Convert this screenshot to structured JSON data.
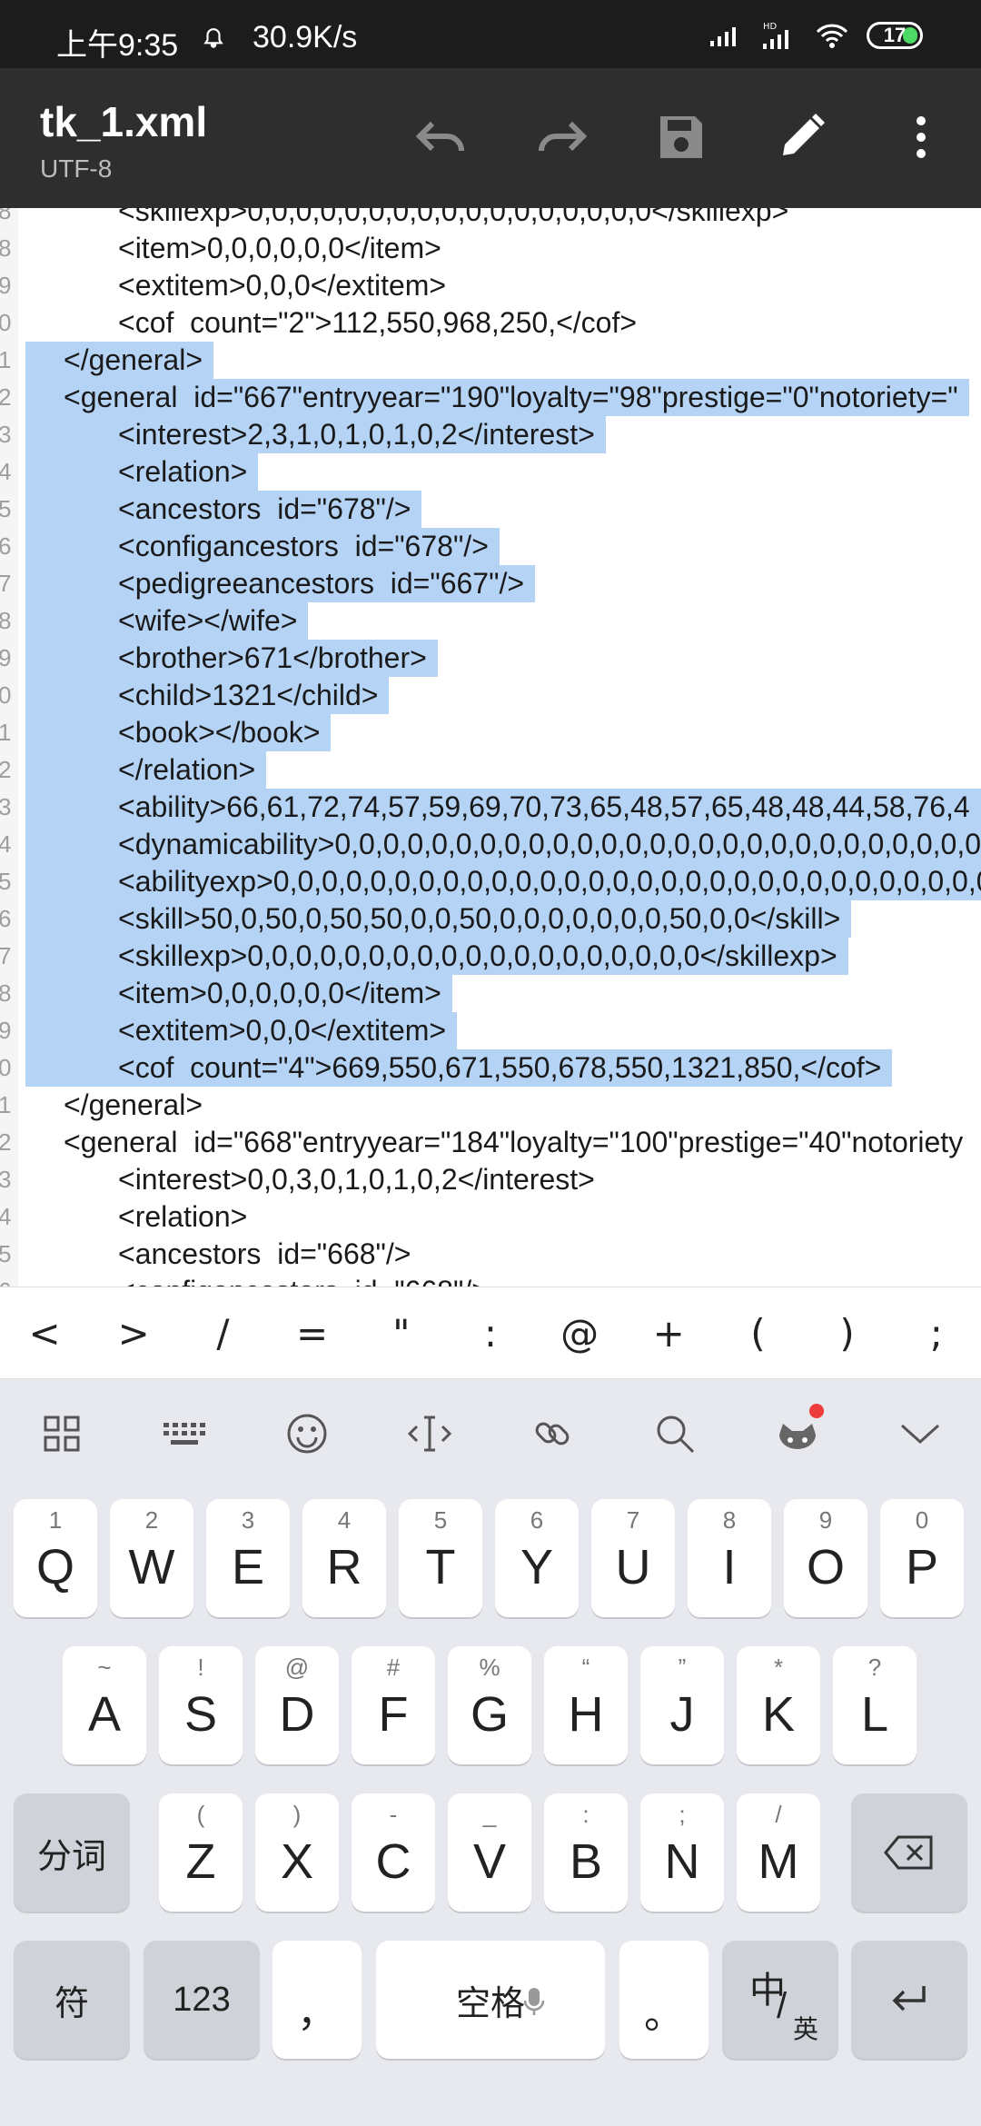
{
  "status": {
    "time": "上午9:35",
    "speed": "30.9K/s",
    "battery": "17"
  },
  "app": {
    "title": "tk_1.xml",
    "encoding": "UTF-8"
  },
  "editor": {
    "lines": [
      {
        "n": "8",
        "t": "<skillexp>0,0,0,0,0,0,0,0,0,0,0,0,0,0,0,0,0</skillexp>",
        "ind": 2,
        "sel": false
      },
      {
        "n": "8",
        "t": "<item>0,0,0,0,0,0</item>",
        "ind": 2,
        "sel": false
      },
      {
        "n": "9",
        "t": "<extitem>0,0,0</extitem>",
        "ind": 2,
        "sel": false
      },
      {
        "n": "0",
        "t": "<cof  count=\"2\">112,550,968,250,</cof>",
        "ind": 2,
        "sel": false
      },
      {
        "n": "1",
        "t": "</general>",
        "ind": 1,
        "sel": true
      },
      {
        "n": "2",
        "t": "<general  id=\"667\"entryyear=\"190\"loyalty=\"98\"prestige=\"0\"notoriety=\"",
        "ind": 1,
        "sel": true
      },
      {
        "n": "3",
        "t": "<interest>2,3,1,0,1,0,1,0,2</interest>",
        "ind": 2,
        "sel": true
      },
      {
        "n": "4",
        "t": "<relation>",
        "ind": 2,
        "sel": true
      },
      {
        "n": "5",
        "t": "<ancestors  id=\"678\"/>",
        "ind": 2,
        "sel": true
      },
      {
        "n": "6",
        "t": "<configancestors  id=\"678\"/>",
        "ind": 2,
        "sel": true
      },
      {
        "n": "7",
        "t": "<pedigreeancestors  id=\"667\"/>",
        "ind": 2,
        "sel": true
      },
      {
        "n": "8",
        "t": "<wife></wife>",
        "ind": 2,
        "sel": true
      },
      {
        "n": "9",
        "t": "<brother>671</brother>",
        "ind": 2,
        "sel": true
      },
      {
        "n": "0",
        "t": "<child>1321</child>",
        "ind": 2,
        "sel": true
      },
      {
        "n": "1",
        "t": "<book></book>",
        "ind": 2,
        "sel": true
      },
      {
        "n": "2",
        "t": "</relation>",
        "ind": 2,
        "sel": true
      },
      {
        "n": "3",
        "t": "<ability>66,61,72,74,57,59,69,70,73,65,48,57,65,48,48,44,58,76,4",
        "ind": 2,
        "sel": true
      },
      {
        "n": "4",
        "t": "<dynamicability>0,0,0,0,0,0,0,0,0,0,0,0,0,0,0,0,0,0,0,0,0,0,0,0,0,0,0,0",
        "ind": 2,
        "sel": true
      },
      {
        "n": "5",
        "t": "<abilityexp>0,0,0,0,0,0,0,0,0,0,0,0,0,0,0,0,0,0,0,0,0,0,0,0,0,0,0,0,0,0",
        "ind": 2,
        "sel": true
      },
      {
        "n": "6",
        "t": "<skill>50,0,50,0,50,50,0,0,50,0,0,0,0,0,0,0,50,0,0</skill>",
        "ind": 2,
        "sel": true
      },
      {
        "n": "7",
        "t": "<skillexp>0,0,0,0,0,0,0,0,0,0,0,0,0,0,0,0,0,0,0</skillexp>",
        "ind": 2,
        "sel": true
      },
      {
        "n": "8",
        "t": "<item>0,0,0,0,0,0</item>",
        "ind": 2,
        "sel": true
      },
      {
        "n": "9",
        "t": "<extitem>0,0,0</extitem>",
        "ind": 2,
        "sel": true
      },
      {
        "n": "0",
        "t": "<cof  count=\"4\">669,550,671,550,678,550,1321,850,</cof>",
        "ind": 2,
        "sel": true
      },
      {
        "n": "1",
        "t": "</general>",
        "ind": 1,
        "sel": false
      },
      {
        "n": "2",
        "t": "<general  id=\"668\"entryyear=\"184\"loyalty=\"100\"prestige=\"40\"notoriety",
        "ind": 1,
        "sel": false
      },
      {
        "n": "3",
        "t": "<interest>0,0,3,0,1,0,1,0,2</interest>",
        "ind": 2,
        "sel": false
      },
      {
        "n": "4",
        "t": "<relation>",
        "ind": 2,
        "sel": false
      },
      {
        "n": "5",
        "t": "<ancestors  id=\"668\"/>",
        "ind": 2,
        "sel": false
      },
      {
        "n": "6",
        "t": "<configancestors  id=\"668\"/>",
        "ind": 2,
        "sel": false
      }
    ]
  },
  "symbols": [
    "<",
    ">",
    "/",
    "=",
    "\"",
    ":",
    "@",
    "+",
    "(",
    ")",
    ";"
  ],
  "keyboard": {
    "row1": [
      {
        "h": "1",
        "k": "Q"
      },
      {
        "h": "2",
        "k": "W"
      },
      {
        "h": "3",
        "k": "E"
      },
      {
        "h": "4",
        "k": "R"
      },
      {
        "h": "5",
        "k": "T"
      },
      {
        "h": "6",
        "k": "Y"
      },
      {
        "h": "7",
        "k": "U"
      },
      {
        "h": "8",
        "k": "I"
      },
      {
        "h": "9",
        "k": "O"
      },
      {
        "h": "0",
        "k": "P"
      }
    ],
    "row2": [
      {
        "h": "~",
        "k": "A"
      },
      {
        "h": "!",
        "k": "S"
      },
      {
        "h": "@",
        "k": "D"
      },
      {
        "h": "#",
        "k": "F"
      },
      {
        "h": "%",
        "k": "G"
      },
      {
        "h": "“",
        "k": "H"
      },
      {
        "h": "”",
        "k": "J"
      },
      {
        "h": "*",
        "k": "K"
      },
      {
        "h": "?",
        "k": "L"
      }
    ],
    "row3": [
      {
        "h": "(",
        "k": "Z"
      },
      {
        "h": ")",
        "k": "X"
      },
      {
        "h": "-",
        "k": "C"
      },
      {
        "h": "_",
        "k": "V"
      },
      {
        "h": ":",
        "k": "B"
      },
      {
        "h": ";",
        "k": "N"
      },
      {
        "h": "/",
        "k": "M"
      }
    ],
    "fenci": "分词",
    "fu": "符",
    "num": "123",
    "comma": "，",
    "space": "空格",
    "period": "。",
    "zh": "中",
    "en": "英"
  }
}
